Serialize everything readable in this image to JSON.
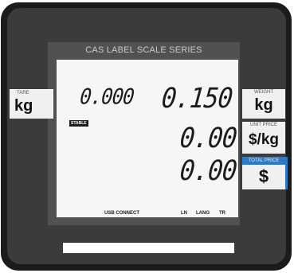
{
  "window": {
    "title": "CAS LABEL SCALE SERIES"
  },
  "panels": {
    "tare": {
      "label": "TARE",
      "unit": "kg"
    },
    "weight": {
      "label": "WEIGHT",
      "unit": "kg"
    },
    "unit_price": {
      "label": "UNIT PRICE",
      "unit": "$/kg"
    },
    "total_price": {
      "label": "TOTAL PRICE",
      "unit": "$"
    }
  },
  "display": {
    "tare_value": "0.000",
    "weight_value": "0.150",
    "unit_price_value": "0.00",
    "total_price_value": "0.00",
    "stable_label": "STABLE",
    "indicators": {
      "usb": "USB CONNECT",
      "ln": "LN",
      "lang": "LANG",
      "tr": "TR"
    }
  },
  "colors": {
    "bezel": "#1b1b1c",
    "panel": "#3a3b3d",
    "lcd_background": "#f6f6f6",
    "total_price_accent": "#2b79c9"
  }
}
